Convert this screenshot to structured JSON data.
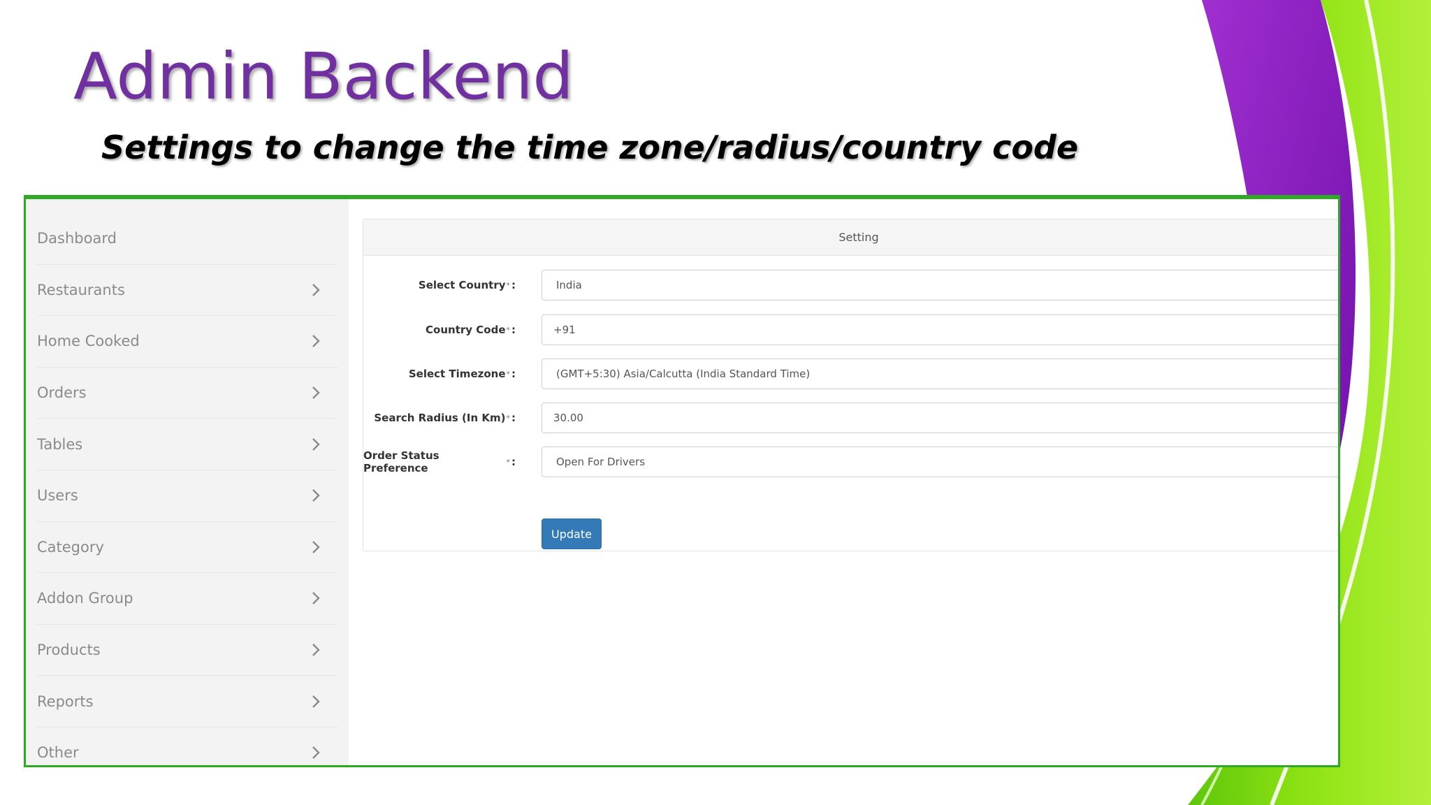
{
  "slide": {
    "title": "Admin Backend",
    "subtitle": "Settings to change the time zone/radius/country code",
    "colors": {
      "title": "#7030a0",
      "frame": "#2fa824",
      "purple_swoosh": "#8a19b5",
      "green_swoosh": "#7ddc10"
    }
  },
  "sidebar": {
    "items": [
      {
        "label": "Dashboard",
        "icon": ""
      },
      {
        "label": "Restaurants",
        "icon": "chevron-right-icon"
      },
      {
        "label": "Home Cooked",
        "icon": "chevron-right-icon"
      },
      {
        "label": "Orders",
        "icon": "chevron-right-icon"
      },
      {
        "label": "Tables",
        "icon": "chevron-right-icon"
      },
      {
        "label": "Users",
        "icon": "chevron-right-icon"
      },
      {
        "label": "Category",
        "icon": "chevron-right-icon"
      },
      {
        "label": "Addon Group",
        "icon": "chevron-right-icon"
      },
      {
        "label": "Products",
        "icon": "chevron-right-icon"
      },
      {
        "label": "Reports",
        "icon": "chevron-right-icon"
      },
      {
        "label": "Other",
        "icon": "chevron-right-icon"
      }
    ]
  },
  "panel": {
    "heading": "Setting",
    "required_mark": "*",
    "fields": [
      {
        "label": "Select Country",
        "value": "India",
        "type": "select"
      },
      {
        "label": "Country Code",
        "value": "+91",
        "type": "input"
      },
      {
        "label": "Select Timezone",
        "value": "(GMT+5:30) Asia/Calcutta (India Standard Time)",
        "type": "select"
      },
      {
        "label": "Search Radius (In Km)",
        "value": "30.00",
        "type": "input"
      },
      {
        "label": "Order Status Preference",
        "value": "Open For Drivers",
        "type": "select"
      }
    ],
    "submit_label": "Update"
  }
}
